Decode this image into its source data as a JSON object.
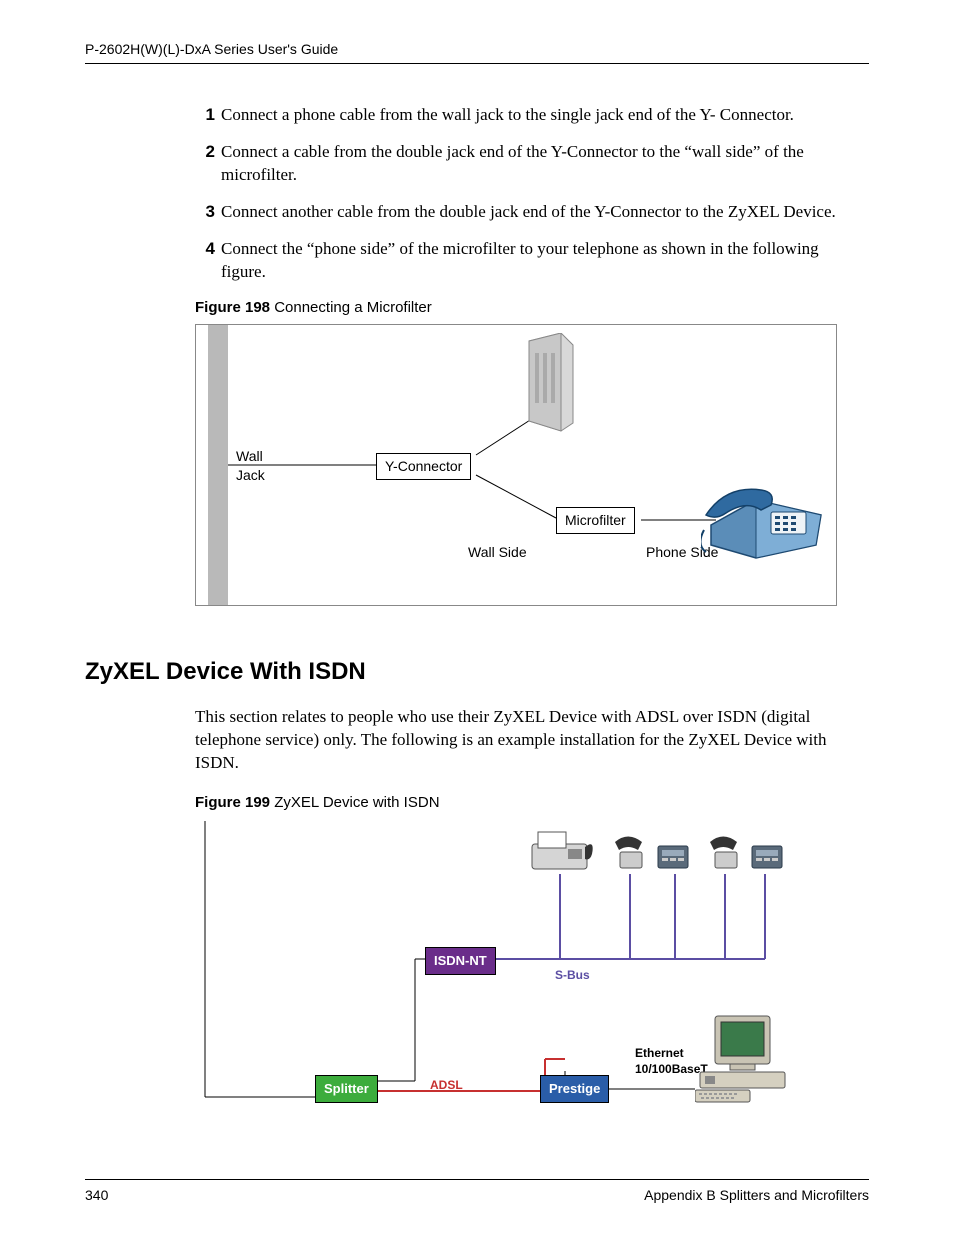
{
  "header": {
    "title": "P-2602H(W)(L)-DxA Series User's Guide"
  },
  "steps": [
    {
      "n": "1",
      "t": "Connect a phone cable from the wall jack to the single jack end of the Y- Connector."
    },
    {
      "n": "2",
      "t": "Connect a cable from the double jack end of the Y-Connector to the “wall side” of the microfilter."
    },
    {
      "n": "3",
      "t": "Connect another cable from the double jack end of the Y-Connector to the ZyXEL Device."
    },
    {
      "n": "4",
      "t": "Connect the “phone side” of the microfilter to your telephone as shown in the following figure."
    }
  ],
  "figure198": {
    "caption_bold": "Figure 198",
    "caption_rest": "   Connecting a Microfilter",
    "labels": {
      "wall_jack_1": "Wall",
      "wall_jack_2": "Jack",
      "y_connector": "Y-Connector",
      "microfilter": "Microfilter",
      "wall_side": "Wall Side",
      "phone_side": "Phone Side"
    }
  },
  "section_heading": "ZyXEL Device With ISDN",
  "section_para": "This section relates to people who use their ZyXEL Device with ADSL over ISDN (digital telephone service) only. The following is an example installation for the ZyXEL Device with ISDN.",
  "figure199": {
    "caption_bold": "Figure 199",
    "caption_rest": "   ZyXEL Device with ISDN",
    "labels": {
      "isdn_nt": "ISDN-NT",
      "sbus": "S-Bus",
      "splitter": "Splitter",
      "adsl": "ADSL",
      "prestige": "Prestige",
      "ethernet1": "Ethernet",
      "ethernet2": "10/100BaseT"
    }
  },
  "footer": {
    "page": "340",
    "appendix": "Appendix B Splitters and Microfilters"
  }
}
